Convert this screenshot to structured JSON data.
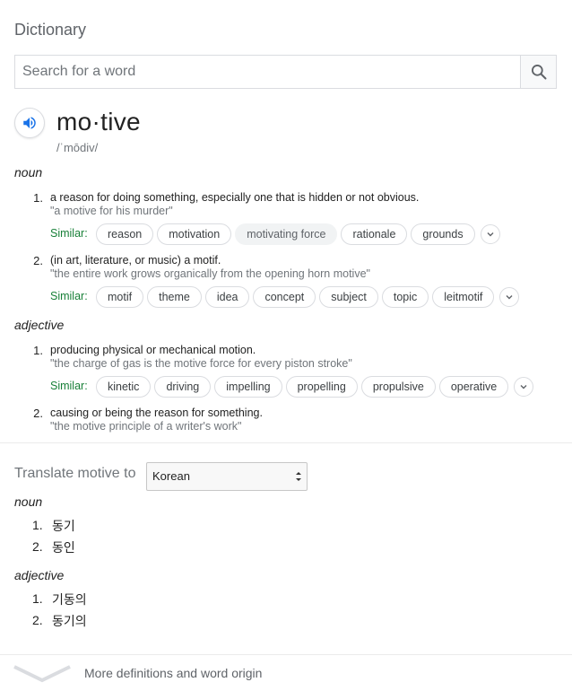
{
  "header": {
    "title": "Dictionary"
  },
  "search": {
    "placeholder": "Search for a word"
  },
  "entry": {
    "word": "mo·tive",
    "phonetic": "/ˈmōdiv/"
  },
  "noun": {
    "label": "noun",
    "senses": [
      {
        "num": "1.",
        "definition": "a reason for doing something, especially one that is hidden or not obvious.",
        "example": "\"a motive for his murder\"",
        "similar_label": "Similar:",
        "similar": [
          "reason",
          "motivation",
          "motivating force",
          "rationale",
          "grounds"
        ]
      },
      {
        "num": "2.",
        "definition": "(in art, literature, or music) a motif.",
        "example": "\"the entire work grows organically from the opening horn motive\"",
        "similar_label": "Similar:",
        "similar": [
          "motif",
          "theme",
          "idea",
          "concept",
          "subject",
          "topic",
          "leitmotif"
        ]
      }
    ]
  },
  "adjective": {
    "label": "adjective",
    "senses": [
      {
        "num": "1.",
        "definition": "producing physical or mechanical motion.",
        "example": "\"the charge of gas is the motive force for every piston stroke\"",
        "similar_label": "Similar:",
        "similar": [
          "kinetic",
          "driving",
          "impelling",
          "propelling",
          "propulsive",
          "operative"
        ]
      },
      {
        "num": "2.",
        "definition": "causing or being the reason for something.",
        "example": "\"the motive principle of a writer's work\""
      }
    ]
  },
  "translate": {
    "label": "Translate motive to",
    "language": "Korean",
    "noun_label": "noun",
    "noun_items": [
      {
        "num": "1.",
        "word": "동기"
      },
      {
        "num": "2.",
        "word": "동인"
      }
    ],
    "adjective_label": "adjective",
    "adjective_items": [
      {
        "num": "1.",
        "word": "기동의"
      },
      {
        "num": "2.",
        "word": "동기의"
      }
    ]
  },
  "footer": {
    "more_label": "More definitions and word origin"
  },
  "colors": {
    "accent_blue": "#1a73e8",
    "similar_green": "#188038",
    "muted": "#70757a"
  }
}
